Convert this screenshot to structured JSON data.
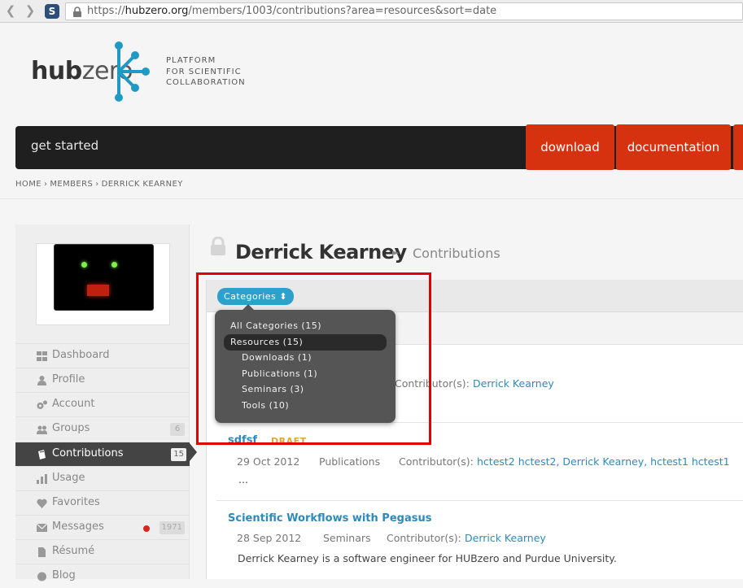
{
  "browser": {
    "url_prefix": "https://",
    "url_domain": "hubzero.org",
    "url_path": "/members/1003/contributions?area=resources&sort=date",
    "site_badge": "S",
    "back": "❮",
    "forward": "❯"
  },
  "logo": {
    "hub": "hub",
    "zero": "zero",
    "tagline": [
      "PLATFORM",
      "FOR SCIENTIFIC",
      "COLLABORATION"
    ]
  },
  "nav": {
    "get_started": "get started",
    "download": "download",
    "documentation": "documentation"
  },
  "breadcrumb": {
    "items": [
      "HOME",
      "MEMBERS",
      "DERRICK KEARNEY"
    ],
    "separator": "›"
  },
  "sidebar": {
    "items": [
      {
        "label": "Dashboard",
        "icon": "dashboard-icon"
      },
      {
        "label": "Profile",
        "icon": "profile-icon"
      },
      {
        "label": "Account",
        "icon": "account-icon"
      },
      {
        "label": "Groups",
        "icon": "groups-icon",
        "count": "6"
      },
      {
        "label": "Contributions",
        "icon": "contributions-icon",
        "count": "15",
        "active": true
      },
      {
        "label": "Usage",
        "icon": "usage-icon"
      },
      {
        "label": "Favorites",
        "icon": "favorites-icon"
      },
      {
        "label": "Messages",
        "icon": "messages-icon",
        "count": "1971"
      },
      {
        "label": "Résumé",
        "icon": "resume-icon"
      },
      {
        "label": "Blog",
        "icon": "blog-icon"
      }
    ]
  },
  "heading": {
    "name": "Derrick Kearney",
    "arrow": "►",
    "section": "Contributions"
  },
  "filter": {
    "button_label": "Categories ⬍",
    "options": [
      {
        "label": "All Categories (15)"
      },
      {
        "label": "Resources (15)",
        "selected": true
      },
      {
        "label": "Downloads (1)"
      },
      {
        "label": "Publications (1)"
      },
      {
        "label": "Seminars (3)"
      },
      {
        "label": "Tools (10)"
      }
    ]
  },
  "results": [
    {
      "contributors_label": "Contributor(s):",
      "contributors": "Derrick Kearney"
    },
    {
      "title": "sdfsf",
      "badge": "DRAFT",
      "date": "29 Oct 2012",
      "category": "Publications",
      "contributors_label": "Contributor(s):",
      "contributors": "hctest2 hctest2, Derrick Kearney, hctest1 hctest1",
      "description": "..."
    },
    {
      "title": "Scientific Workflows with Pegasus",
      "date": "28 Sep 2012",
      "category": "Seminars",
      "contributors_label": "Contributor(s):",
      "contributors": "Derrick Kearney",
      "description": "Derrick Kearney is a software engineer for HUBzero and Purdue University."
    }
  ],
  "colors": {
    "accent": "#2da1c9",
    "nav_red": "#d7320f",
    "highlight_box": "#e00000",
    "draft": "#e2a531"
  }
}
